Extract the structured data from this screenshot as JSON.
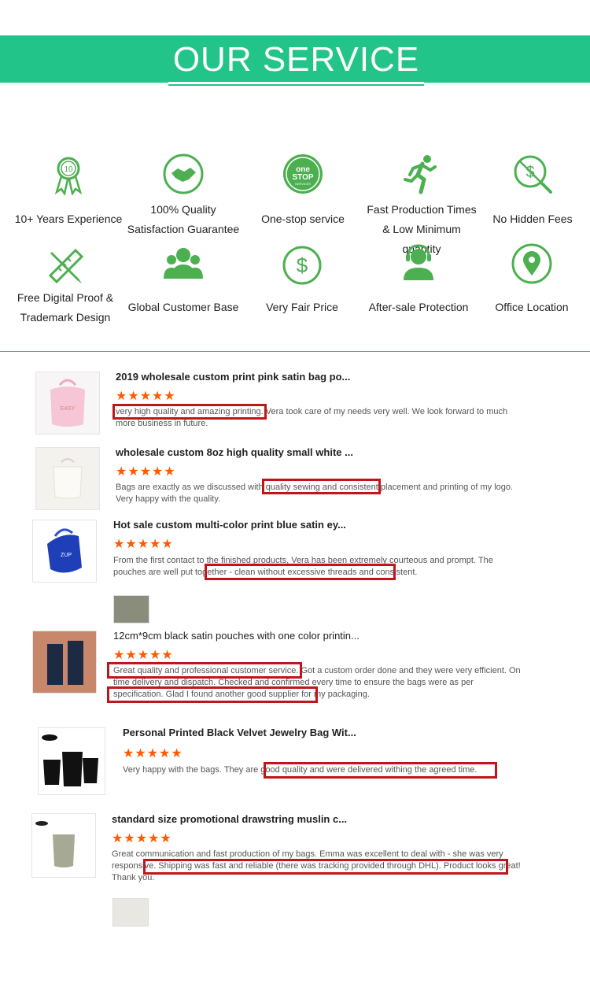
{
  "header": {
    "title": "OUR SERVICE"
  },
  "services": [
    {
      "icon": "award-badge-icon",
      "label": "10+ Years Experience"
    },
    {
      "icon": "handshake-icon",
      "label": "100% Quality Satisfaction Guarantee"
    },
    {
      "icon": "one-stop-icon",
      "icon_text": "one STOP SERVICES",
      "label": "One-stop service"
    },
    {
      "icon": "running-man-icon",
      "label": "Fast Production Times & Low Minimum quantity"
    },
    {
      "icon": "no-hidden-fees-icon",
      "label": "No Hidden Fees"
    },
    {
      "icon": "ruler-pencil-icon",
      "label": "Free Digital Proof & Trademark Design"
    },
    {
      "icon": "customer-group-icon",
      "label": "Global Customer Base"
    },
    {
      "icon": "dollar-circle-icon",
      "label": "Very Fair Price"
    },
    {
      "icon": "headset-agent-icon",
      "label": "After-sale Protection"
    },
    {
      "icon": "location-pin-icon",
      "label": "Office Location"
    }
  ],
  "reviews": [
    {
      "title": "2019 wholesale custom print pink satin bag po...",
      "stars": "★★★★★",
      "text": "very high quality and amazing printing. Vera took care of my needs very well. We look forward to much more business in future.",
      "highlights": [
        "very high quality and amazing printing."
      ]
    },
    {
      "title": "wholesale custom 8oz high quality small white ...",
      "stars": "★★★★★",
      "text": "Bags are exactly as we discussed with quality sewing and consistent placement and printing of my logo. Very happy with the quality.",
      "highlights": [
        "quality sewing and consistent"
      ]
    },
    {
      "title": "Hot sale custom multi-color print blue satin ey...",
      "stars": "★★★★★",
      "text": "From the first contact to the finished products, Vera has been extremely courteous and prompt. The pouches are well put together - clean without excessive threads and consistent.",
      "highlights": [
        "clean without excessive threads and consistent."
      ]
    },
    {
      "title": "12cm*9cm black satin pouches with one color printin...",
      "stars": "★★★★★",
      "text": "Great quality and professional customer service. Got a custom order done and they were very efficient. On time delivery and dispatch. Checked and confirmed every time to ensure the bags were as per specification. Glad I found another good supplier for my packaging.",
      "highlights": [
        "Great quality and professional customer service.",
        "Glad I found another good supplier for my packaging."
      ]
    },
    {
      "title": "Personal Printed Black Velvet Jewelry Bag Wit...",
      "stars": "★★★★★",
      "text": "Very happy with the bags. They are good quality and were delivered withing the agreed time.",
      "highlights": [
        "good quality and were delivered withing the agreed time."
      ]
    },
    {
      "title": "standard size promotional drawstring muslin c...",
      "stars": "★★★★★",
      "text": "Great communication and fast production of my bags. Emma was excellent to deal with - she was very responsive. Shipping was fast and reliable (there was tracking provided through DHL). Product looks great! Thank you.",
      "highlights": [
        "Shipping was fast and reliable (there was tracking provided through DHL). Product looks great!"
      ]
    }
  ],
  "colors": {
    "accent": "#22c48a",
    "icon": "#4caf50",
    "star": "#ff5a00",
    "highlight_box": "#c0151b"
  }
}
